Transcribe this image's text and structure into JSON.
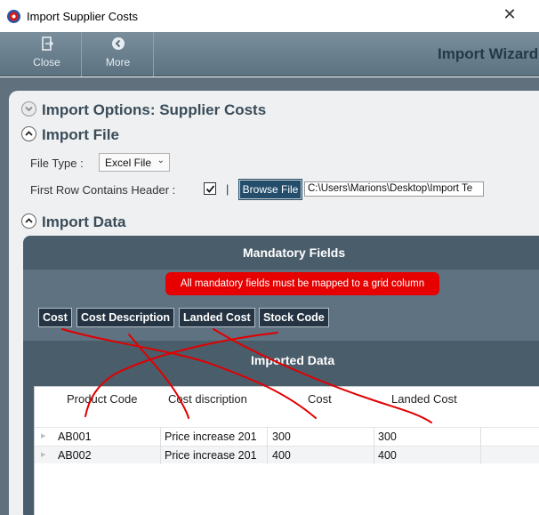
{
  "window": {
    "title": "Import Supplier Costs",
    "close_glyph": "✕"
  },
  "toolbar": {
    "close_label": "Close",
    "more_label": "More",
    "wizard_title": "Import Wizard"
  },
  "sections": {
    "options_title": "Import Options: Supplier Costs",
    "file_title": "Import File",
    "data_title": "Import Data"
  },
  "import_file": {
    "file_type_label": "File Type :",
    "file_type_value": "Excel File",
    "header_label": "First Row Contains Header :",
    "header_checked": true,
    "separator": "|",
    "browse_label": "Browse File",
    "path_value": "C:\\Users\\Marions\\Desktop\\Import Te"
  },
  "mandatory": {
    "title": "Mandatory Fields",
    "alert": "All mandatory fields must be mapped to a grid column",
    "fields": [
      "Cost",
      "Cost Description",
      "Landed Cost",
      "Stock Code"
    ]
  },
  "imported": {
    "title": "Imported Data",
    "columns": [
      "Product Code",
      "Cost discription",
      "Cost",
      "Landed Cost"
    ],
    "rows": [
      [
        "AB001",
        "Price increase 201",
        "300",
        "300"
      ],
      [
        "AB002",
        "Price increase 201",
        "400",
        "400"
      ]
    ]
  },
  "colors": {
    "toolbar": "#6a7f8e",
    "panel_dark": "#4a5d6b",
    "alert": "#e60000",
    "annotation": "#e00000",
    "browse": "#234d6b"
  },
  "icons": {
    "close": "exit-icon",
    "more": "arrow-left-circle-icon",
    "collapse": "chevron-up-icon",
    "expand": "chevron-down-icon"
  }
}
